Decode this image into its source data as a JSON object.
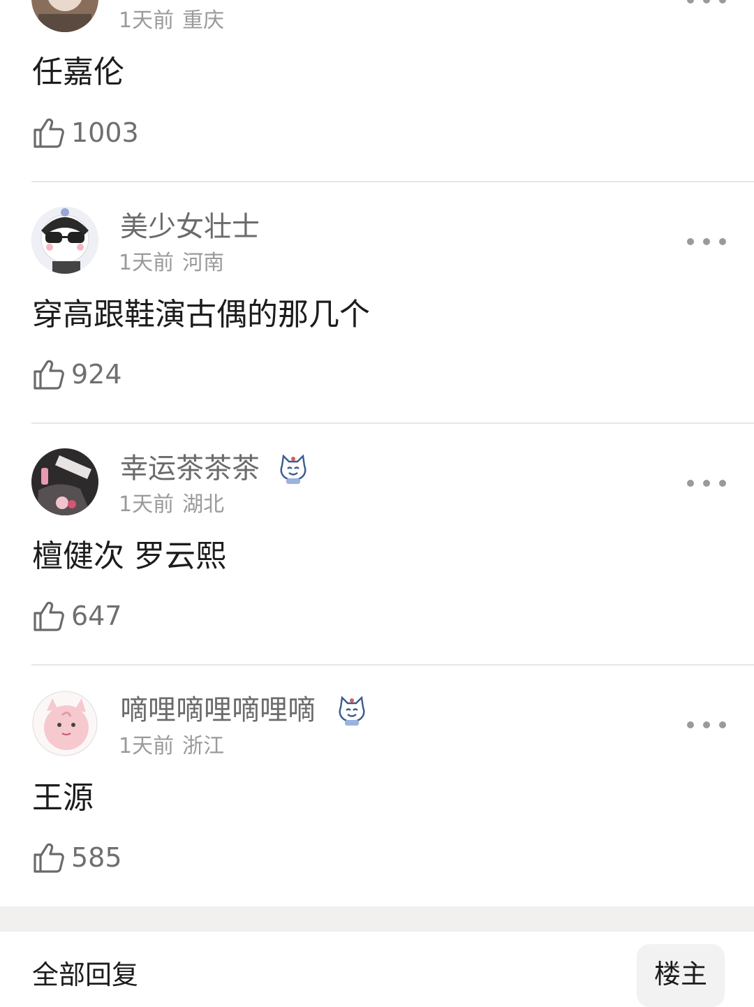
{
  "comments": [
    {
      "username": "",
      "time": "1天前",
      "location": "重庆",
      "text": "任嘉伦",
      "likes": "1003",
      "has_badge": false,
      "avatar_icon": "portrait-photo-avatar"
    },
    {
      "username": "美少女壮士",
      "time": "1天前",
      "location": "河南",
      "text": "穿高跟鞋演古偶的那几个",
      "likes": "924",
      "has_badge": false,
      "avatar_icon": "cartoon-sunglasses-avatar"
    },
    {
      "username": "幸运茶茶茶",
      "time": "1天前",
      "location": "湖北",
      "text": "檀健次 罗云熙",
      "likes": "647",
      "has_badge": true,
      "avatar_icon": "photo-avatar"
    },
    {
      "username": "嘀哩嘀哩嘀哩嘀",
      "time": "1天前",
      "location": "浙江",
      "text": "王源",
      "likes": "585",
      "has_badge": true,
      "avatar_icon": "pink-cartoon-avatar"
    }
  ],
  "footer": {
    "all_replies_label": "全部回复",
    "owner_button_label": "楼主"
  },
  "colors": {
    "secondary_text": "#9a9a9a",
    "username_text": "#6b6b6b",
    "divider": "#e6e6e6",
    "section_gap": "#f1f0ee"
  }
}
